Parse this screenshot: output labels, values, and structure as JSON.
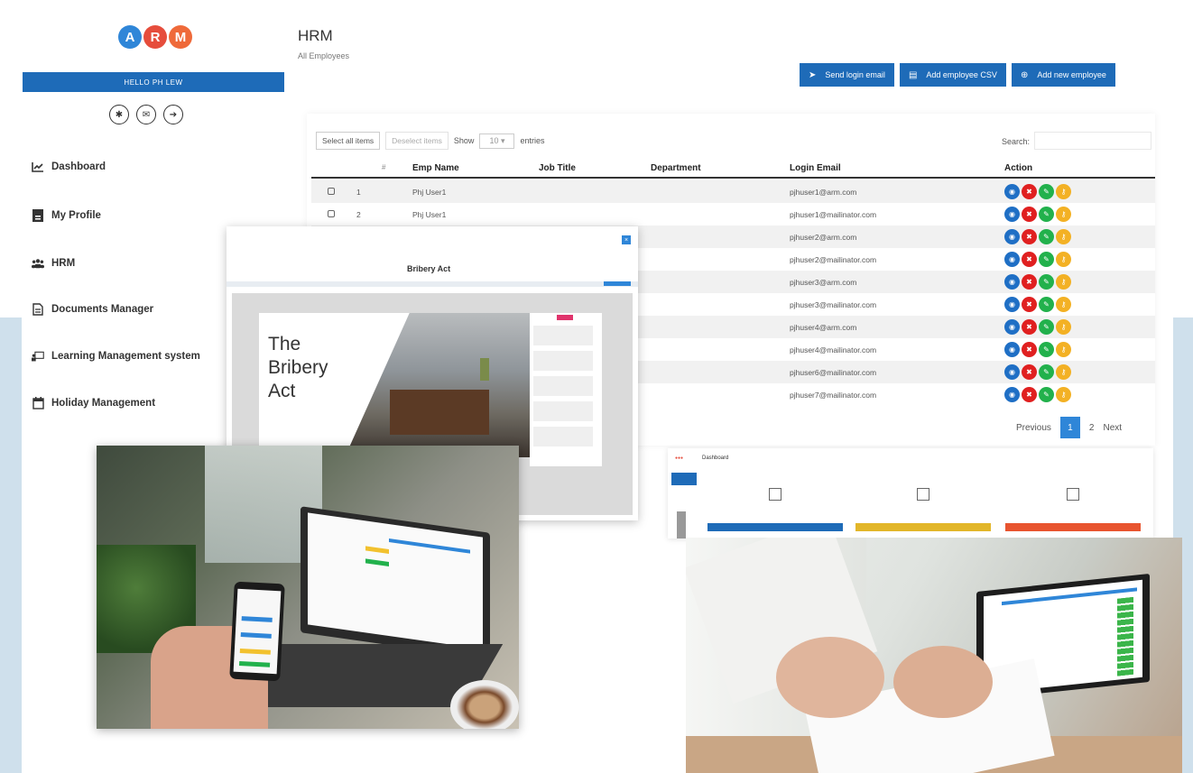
{
  "logo": {
    "letters": [
      "A",
      "R",
      "M"
    ]
  },
  "sidebar": {
    "greeting": "HELLO PH LEW",
    "round_icons": [
      "gear-icon",
      "mail-icon",
      "logout-icon"
    ],
    "items": [
      {
        "label": "Dashboard",
        "icon": "chart-icon"
      },
      {
        "label": "My Profile",
        "icon": "id-card-icon"
      },
      {
        "label": "HRM",
        "icon": "users-icon"
      },
      {
        "label": "Documents Manager",
        "icon": "document-icon"
      },
      {
        "label": "Learning Management system",
        "icon": "monitor-icon"
      },
      {
        "label": "Holiday Management",
        "icon": "calendar-icon"
      }
    ]
  },
  "header": {
    "title": "HRM",
    "subtitle": "All Employees",
    "buttons": {
      "send_login": "Send login email",
      "add_csv": "Add employee CSV",
      "add_new": "Add new employee"
    }
  },
  "table_tools": {
    "select_all": "Select all items",
    "deselect_all": "Deselect items",
    "show": "Show",
    "page_size": "10",
    "entries": "entries",
    "search_label": "Search:"
  },
  "table": {
    "columns": [
      "#",
      "Emp Name",
      "Job Title",
      "Department",
      "Login Email",
      "Action"
    ],
    "rows": [
      {
        "num": "1",
        "name": "Phj User1",
        "email": "pjhuser1@arm.com"
      },
      {
        "num": "2",
        "name": "Phj User1",
        "email": "pjhuser1@mailinator.com"
      },
      {
        "num": "",
        "name": "",
        "email": "pjhuser2@arm.com"
      },
      {
        "num": "",
        "name": "",
        "email": "pjhuser2@mailinator.com"
      },
      {
        "num": "",
        "name": "",
        "email": "pjhuser3@arm.com"
      },
      {
        "num": "",
        "name": "",
        "email": "pjhuser3@mailinator.com"
      },
      {
        "num": "",
        "name": "",
        "email": "pjhuser4@arm.com"
      },
      {
        "num": "",
        "name": "",
        "email": "pjhuser4@mailinator.com"
      },
      {
        "num": "",
        "name": "",
        "email": "pjhuser6@mailinator.com"
      },
      {
        "num": "",
        "name": "",
        "email": "pjhuser7@mailinator.com"
      }
    ],
    "action_colors": [
      "#1f6fc5",
      "#e02020",
      "#22b14c",
      "#f3b124"
    ]
  },
  "pagination": {
    "previous": "Previous",
    "current": "1",
    "next_page": "2",
    "next": "Next"
  },
  "bribery": {
    "title": "Bribery Act",
    "slide_lines": [
      "The",
      "Bribery",
      "Act"
    ]
  },
  "dashboard_card": {
    "label": "Dashboard"
  }
}
